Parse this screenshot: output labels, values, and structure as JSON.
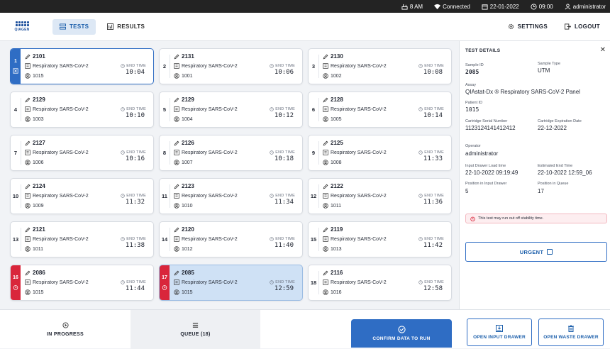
{
  "status_bar": {
    "storage": "8 AM",
    "connection": "Connected",
    "date": "22-01-2022",
    "time": "09:00",
    "user": "administrator"
  },
  "nav": {
    "logo_text": "QIAGEN",
    "tests_label": "TESTS",
    "results_label": "RESULTS",
    "settings_label": "SETTINGS",
    "logout_label": "LOGOUT"
  },
  "cards": [
    {
      "pos": "1",
      "sample": "2101",
      "assay": "Respiratory SARS-CoV-2",
      "patient": "1015",
      "end_label": "END TIME",
      "end_time": "10:04",
      "stripe": "blue",
      "selected": true,
      "highlight": false
    },
    {
      "pos": "2",
      "sample": "2131",
      "assay": "Respiratory SARS-CoV-2",
      "patient": "1001",
      "end_label": "END TIME",
      "end_time": "10:06",
      "stripe": "none",
      "selected": false,
      "highlight": false
    },
    {
      "pos": "3",
      "sample": "2130",
      "assay": "Respiratory SARS-CoV-2",
      "patient": "1002",
      "end_label": "END TIME",
      "end_time": "10:08",
      "stripe": "none",
      "selected": false,
      "highlight": false
    },
    {
      "pos": "4",
      "sample": "2129",
      "assay": "Respiratory SARS-CoV-2",
      "patient": "1003",
      "end_label": "END TIME",
      "end_time": "10:10",
      "stripe": "none",
      "selected": false,
      "highlight": false
    },
    {
      "pos": "5",
      "sample": "2129",
      "assay": "Respiratory SARS-CoV-2",
      "patient": "1004",
      "end_label": "END TIME",
      "end_time": "10:12",
      "stripe": "none",
      "selected": false,
      "highlight": false
    },
    {
      "pos": "6",
      "sample": "2128",
      "assay": "Respiratory SARS-CoV-2",
      "patient": "1005",
      "end_label": "END TIME",
      "end_time": "10:14",
      "stripe": "none",
      "selected": false,
      "highlight": false
    },
    {
      "pos": "7",
      "sample": "2127",
      "assay": "Respiratory SARS-CoV-2",
      "patient": "1006",
      "end_label": "END TIME",
      "end_time": "10:16",
      "stripe": "none",
      "selected": false,
      "highlight": false
    },
    {
      "pos": "8",
      "sample": "2126",
      "assay": "Respiratory SARS-CoV-2",
      "patient": "1007",
      "end_label": "END TIME",
      "end_time": "10:18",
      "stripe": "none",
      "selected": false,
      "highlight": false
    },
    {
      "pos": "9",
      "sample": "2125",
      "assay": "Respiratory SARS-CoV-2",
      "patient": "1008",
      "end_label": "END TIME",
      "end_time": "11:33",
      "stripe": "none",
      "selected": false,
      "highlight": false
    },
    {
      "pos": "10",
      "sample": "2124",
      "assay": "Respiratory SARS-CoV-2",
      "patient": "1009",
      "end_label": "END TIME",
      "end_time": "11:32",
      "stripe": "none",
      "selected": false,
      "highlight": false
    },
    {
      "pos": "11",
      "sample": "2123",
      "assay": "Respiratory SARS-CoV-2",
      "patient": "1010",
      "end_label": "END TIME",
      "end_time": "11:34",
      "stripe": "none",
      "selected": false,
      "highlight": false
    },
    {
      "pos": "12",
      "sample": "2122",
      "assay": "Respiratory SARS-CoV-2",
      "patient": "1011",
      "end_label": "END TIME",
      "end_time": "11:36",
      "stripe": "none",
      "selected": false,
      "highlight": false
    },
    {
      "pos": "13",
      "sample": "2121",
      "assay": "Respiratory SARS-CoV-2",
      "patient": "1011",
      "end_label": "END TIME",
      "end_time": "11:38",
      "stripe": "none",
      "selected": false,
      "highlight": false
    },
    {
      "pos": "14",
      "sample": "2120",
      "assay": "Respiratory SARS-CoV-2",
      "patient": "1012",
      "end_label": "END TIME",
      "end_time": "11:40",
      "stripe": "none",
      "selected": false,
      "highlight": false
    },
    {
      "pos": "15",
      "sample": "2119",
      "assay": "Respiratory SARS-CoV-2",
      "patient": "1013",
      "end_label": "END TIME",
      "end_time": "11:42",
      "stripe": "none",
      "selected": false,
      "highlight": false
    },
    {
      "pos": "16",
      "sample": "2086",
      "assay": "Respiratory SARS-CoV-2",
      "patient": "1015",
      "end_label": "END TIME",
      "end_time": "11:44",
      "stripe": "red",
      "selected": false,
      "highlight": false
    },
    {
      "pos": "17",
      "sample": "2085",
      "assay": "Respiratory SARS-CoV-2",
      "patient": "1015",
      "end_label": "END TIME",
      "end_time": "12:59",
      "stripe": "red",
      "selected": false,
      "highlight": true
    },
    {
      "pos": "18",
      "sample": "2116",
      "assay": "Respiratory SARS-CoV-2",
      "patient": "1016",
      "end_label": "END TIME",
      "end_time": "12:58",
      "stripe": "none",
      "selected": false,
      "highlight": false
    }
  ],
  "details": {
    "title": "TEST DETAILS",
    "sample_id_label": "Sample ID",
    "sample_id": "2085",
    "sample_type_label": "Sample Type",
    "sample_type": "UTM",
    "assay_label": "Assay",
    "assay": "QIAstat-Dx ® Respiratory SARS-CoV-2 Panel",
    "patient_id_label": "Patient ID",
    "patient_id": "1015",
    "cartridge_serial_label": "Cartridge Serial Number",
    "cartridge_serial": "1123124141412412",
    "cartridge_exp_label": "Cartridge Expiration Date",
    "cartridge_exp": "22-12-2022",
    "operator_label": "Operator",
    "operator": "administrator",
    "load_time_label": "Input Drawer Load time",
    "load_time": "22-10-2022 09:19:49",
    "est_end_label": "Estimated End Time",
    "est_end": "22-10-2022 12:59_06",
    "drawer_pos_label": "Position in Input Drawer",
    "drawer_pos": "5",
    "queue_pos_label": "Position in Queue",
    "queue_pos": "17",
    "warning": "This test may run out off stability time.",
    "urgent_label": "URGENT"
  },
  "bottom": {
    "in_progress_label": "IN PROGRESS",
    "queue_label": "QUEUE (18)",
    "confirm_label": "CONFIRM DATA TO RUN",
    "input_drawer_label": "OPEN INPUT DRAWER",
    "waste_drawer_label": "OPEN WASTE DRAWER"
  },
  "colors": {
    "accent": "#2f6dc4",
    "alert": "#d9263b",
    "highlight": "#cfe1f5"
  }
}
